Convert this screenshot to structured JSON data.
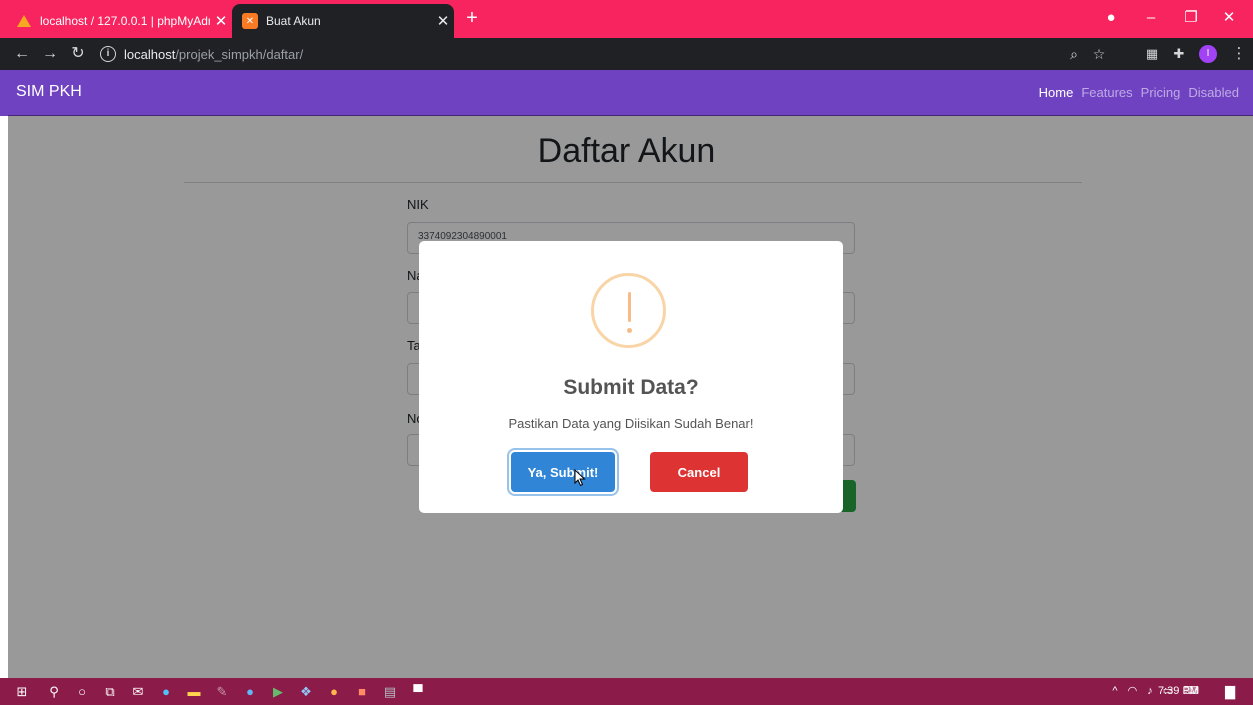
{
  "browser": {
    "tabs": [
      {
        "title": "localhost / 127.0.0.1 | phpMyAdm",
        "active": false,
        "icon": "phpmyadmin-icon"
      },
      {
        "title": "Buat Akun",
        "active": true,
        "icon": "xampp-icon"
      }
    ],
    "url_host": "localhost",
    "url_path": "/projek_simpkh/daftar/",
    "profile_initial": "I"
  },
  "navbar": {
    "brand": "SIM PKH",
    "links": [
      "Home",
      "Features",
      "Pricing",
      "Disabled"
    ]
  },
  "form": {
    "title": "Daftar Akun",
    "nik_label": "NIK",
    "nik_value": "3374092304890001",
    "label_2_partial": "Na",
    "label_3_partial": "Ta",
    "label_4_partial": "No"
  },
  "modal": {
    "title": "Submit Data?",
    "text": "Pastikan Data yang Diisikan Sudah Benar!",
    "confirm_label": "Ya, Submit!",
    "cancel_label": "Cancel",
    "icon": "exclamation-icon"
  },
  "taskbar": {
    "time": "7:39 PM"
  },
  "colors": {
    "tabbar": "#f7245f",
    "navbar": "#6f42c1",
    "confirm": "#3085d6",
    "cancel": "#dd3333",
    "taskbar": "#8b1b49"
  }
}
